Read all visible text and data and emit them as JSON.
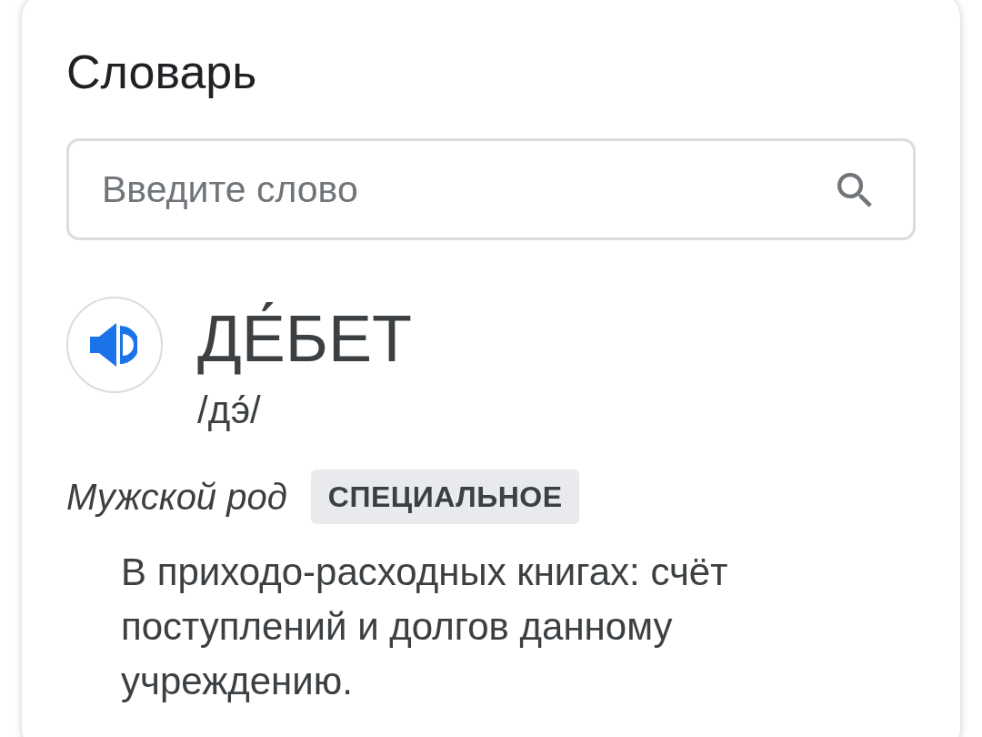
{
  "card": {
    "title": "Словарь"
  },
  "search": {
    "placeholder": "Введите слово"
  },
  "entry": {
    "word": "ДЕ́БЕТ",
    "pronunciation": "/дэ́/",
    "gender": "Мужской род",
    "tag": "СПЕЦИАЛЬНОЕ",
    "definition": "В приходо-расходных книгах: счёт поступлений и долгов данному учреждению."
  }
}
